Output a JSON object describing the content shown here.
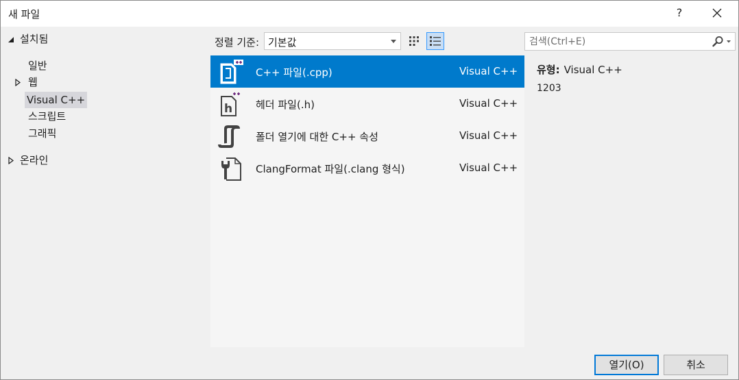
{
  "window": {
    "title": "새 파일",
    "help_label": "?",
    "close_icon": "close-icon"
  },
  "tree": {
    "installed": {
      "label": "설치됨",
      "expanded": true
    },
    "items": [
      {
        "label": "일반"
      },
      {
        "label": "웹",
        "expandable": true
      },
      {
        "label": "Visual C++",
        "selected": true
      },
      {
        "label": "스크립트"
      },
      {
        "label": "그래픽"
      }
    ],
    "online": {
      "label": "온라인",
      "expanded": false
    }
  },
  "toolbar": {
    "sort_label": "정렬 기준:",
    "sort_value": "기본값",
    "view_small_icons": "small-icons-view-icon",
    "view_list": "list-view-icon",
    "active_view": "list"
  },
  "search": {
    "placeholder": "검색(Ctrl+E)",
    "icon": "search-icon"
  },
  "templates": [
    {
      "name": "C++ 파일(.cpp)",
      "lang": "Visual C++",
      "icon": "cpp-file-icon",
      "selected": true
    },
    {
      "name": "헤더 파일(.h)",
      "lang": "Visual C++",
      "icon": "header-file-icon"
    },
    {
      "name": "폴더 열기에 대한 C++ 속성",
      "lang": "Visual C++",
      "icon": "cpp-properties-icon"
    },
    {
      "name": "ClangFormat 파일(.clang 형식)",
      "lang": "Visual C++",
      "icon": "clangformat-file-icon"
    }
  ],
  "details": {
    "type_label": "유형:",
    "type_value": "Visual C++",
    "description": "1203"
  },
  "buttons": {
    "open": "열기(O)",
    "cancel": "취소"
  },
  "colors": {
    "selection": "#007acc",
    "accent_purple": "#68217a"
  }
}
